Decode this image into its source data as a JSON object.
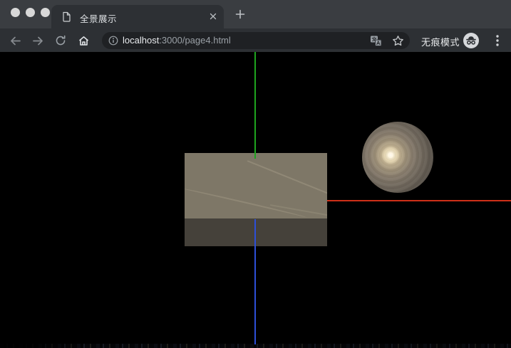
{
  "browser": {
    "window_controls": {
      "close_icon": "circle",
      "minimize_icon": "circle",
      "zoom_icon": "circle",
      "color": "#d8d8d8"
    },
    "tab": {
      "title": "全景展示",
      "favicon": "page-icon",
      "close_icon": "x"
    },
    "new_tab_icon": "+",
    "toolbar_icons": {
      "back": "left-arrow",
      "forward": "right-arrow",
      "reload": "circular-arrow",
      "home": "house",
      "site_info": "info-circle",
      "translate": "translate-glyph",
      "bookmark": "star-outline",
      "menu": "vertical-ellipsis"
    },
    "address_bar": {
      "host": "localhost",
      "path": ":3000/page4.html"
    },
    "incognito": {
      "label": "无痕模式",
      "badge_icon": "spy-hat-glasses"
    },
    "colors": {
      "frame": "#3a3d41",
      "toolbar": "#2d3034",
      "omnibox": "#1f2124",
      "url_host": "#e8eaed",
      "url_path": "#9aa0a6"
    }
  },
  "scene": {
    "background_color": "#000000",
    "axes_helper": {
      "x_axis_color": "#cf3018",
      "y_axis_color": "#1ea41e",
      "z_axis_color": "#2d4fd8"
    },
    "objects": [
      {
        "type": "box",
        "top_face_color": "#7e7767",
        "front_face_color": "#45413a"
      },
      {
        "type": "sphere",
        "highlight_color": "#fffaf0",
        "base_color": "#8f8371"
      },
      {
        "type": "ground-plane-edge",
        "color": "#10141c"
      }
    ]
  }
}
